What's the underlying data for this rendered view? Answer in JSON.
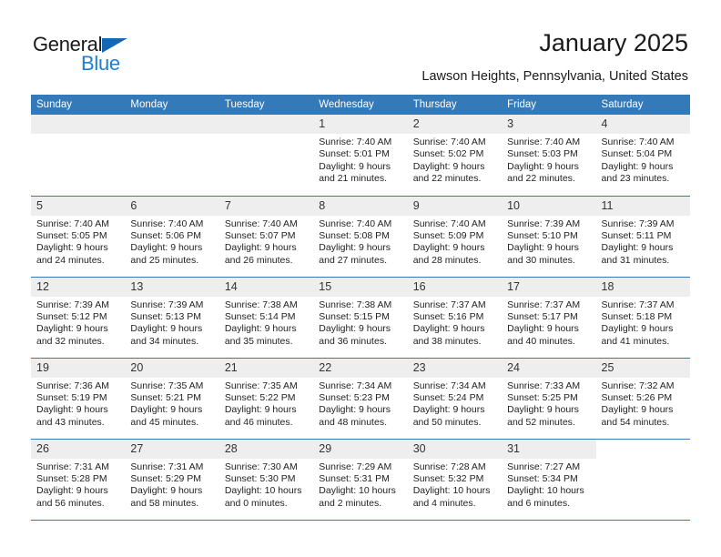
{
  "brand": {
    "name_part1": "General",
    "name_part2": "Blue",
    "color_dark": "#1a1a1a",
    "color_blue": "#1d7fd4",
    "triangle_color": "#1468b3"
  },
  "header": {
    "title": "January 2025",
    "subtitle": "Lawson Heights, Pennsylvania, United States"
  },
  "theme": {
    "header_row_bg": "#3479b8",
    "header_row_text": "#ffffff",
    "daynum_bg": "#eeeeee",
    "row_separator": "#3479b8",
    "page_bg": "#ffffff"
  },
  "calendar": {
    "weekday_headers": [
      "Sunday",
      "Monday",
      "Tuesday",
      "Wednesday",
      "Thursday",
      "Friday",
      "Saturday"
    ],
    "weeks": [
      [
        {
          "day": "",
          "blank": true
        },
        {
          "day": "",
          "blank": true
        },
        {
          "day": "",
          "blank": true
        },
        {
          "day": "1",
          "sunrise": "Sunrise: 7:40 AM",
          "sunset": "Sunset: 5:01 PM",
          "daylight1": "Daylight: 9 hours",
          "daylight2": "and 21 minutes."
        },
        {
          "day": "2",
          "sunrise": "Sunrise: 7:40 AM",
          "sunset": "Sunset: 5:02 PM",
          "daylight1": "Daylight: 9 hours",
          "daylight2": "and 22 minutes."
        },
        {
          "day": "3",
          "sunrise": "Sunrise: 7:40 AM",
          "sunset": "Sunset: 5:03 PM",
          "daylight1": "Daylight: 9 hours",
          "daylight2": "and 22 minutes."
        },
        {
          "day": "4",
          "sunrise": "Sunrise: 7:40 AM",
          "sunset": "Sunset: 5:04 PM",
          "daylight1": "Daylight: 9 hours",
          "daylight2": "and 23 minutes."
        }
      ],
      [
        {
          "day": "5",
          "sunrise": "Sunrise: 7:40 AM",
          "sunset": "Sunset: 5:05 PM",
          "daylight1": "Daylight: 9 hours",
          "daylight2": "and 24 minutes."
        },
        {
          "day": "6",
          "sunrise": "Sunrise: 7:40 AM",
          "sunset": "Sunset: 5:06 PM",
          "daylight1": "Daylight: 9 hours",
          "daylight2": "and 25 minutes."
        },
        {
          "day": "7",
          "sunrise": "Sunrise: 7:40 AM",
          "sunset": "Sunset: 5:07 PM",
          "daylight1": "Daylight: 9 hours",
          "daylight2": "and 26 minutes."
        },
        {
          "day": "8",
          "sunrise": "Sunrise: 7:40 AM",
          "sunset": "Sunset: 5:08 PM",
          "daylight1": "Daylight: 9 hours",
          "daylight2": "and 27 minutes."
        },
        {
          "day": "9",
          "sunrise": "Sunrise: 7:40 AM",
          "sunset": "Sunset: 5:09 PM",
          "daylight1": "Daylight: 9 hours",
          "daylight2": "and 28 minutes."
        },
        {
          "day": "10",
          "sunrise": "Sunrise: 7:39 AM",
          "sunset": "Sunset: 5:10 PM",
          "daylight1": "Daylight: 9 hours",
          "daylight2": "and 30 minutes."
        },
        {
          "day": "11",
          "sunrise": "Sunrise: 7:39 AM",
          "sunset": "Sunset: 5:11 PM",
          "daylight1": "Daylight: 9 hours",
          "daylight2": "and 31 minutes."
        }
      ],
      [
        {
          "day": "12",
          "sunrise": "Sunrise: 7:39 AM",
          "sunset": "Sunset: 5:12 PM",
          "daylight1": "Daylight: 9 hours",
          "daylight2": "and 32 minutes."
        },
        {
          "day": "13",
          "sunrise": "Sunrise: 7:39 AM",
          "sunset": "Sunset: 5:13 PM",
          "daylight1": "Daylight: 9 hours",
          "daylight2": "and 34 minutes."
        },
        {
          "day": "14",
          "sunrise": "Sunrise: 7:38 AM",
          "sunset": "Sunset: 5:14 PM",
          "daylight1": "Daylight: 9 hours",
          "daylight2": "and 35 minutes."
        },
        {
          "day": "15",
          "sunrise": "Sunrise: 7:38 AM",
          "sunset": "Sunset: 5:15 PM",
          "daylight1": "Daylight: 9 hours",
          "daylight2": "and 36 minutes."
        },
        {
          "day": "16",
          "sunrise": "Sunrise: 7:37 AM",
          "sunset": "Sunset: 5:16 PM",
          "daylight1": "Daylight: 9 hours",
          "daylight2": "and 38 minutes."
        },
        {
          "day": "17",
          "sunrise": "Sunrise: 7:37 AM",
          "sunset": "Sunset: 5:17 PM",
          "daylight1": "Daylight: 9 hours",
          "daylight2": "and 40 minutes."
        },
        {
          "day": "18",
          "sunrise": "Sunrise: 7:37 AM",
          "sunset": "Sunset: 5:18 PM",
          "daylight1": "Daylight: 9 hours",
          "daylight2": "and 41 minutes."
        }
      ],
      [
        {
          "day": "19",
          "sunrise": "Sunrise: 7:36 AM",
          "sunset": "Sunset: 5:19 PM",
          "daylight1": "Daylight: 9 hours",
          "daylight2": "and 43 minutes."
        },
        {
          "day": "20",
          "sunrise": "Sunrise: 7:35 AM",
          "sunset": "Sunset: 5:21 PM",
          "daylight1": "Daylight: 9 hours",
          "daylight2": "and 45 minutes."
        },
        {
          "day": "21",
          "sunrise": "Sunrise: 7:35 AM",
          "sunset": "Sunset: 5:22 PM",
          "daylight1": "Daylight: 9 hours",
          "daylight2": "and 46 minutes."
        },
        {
          "day": "22",
          "sunrise": "Sunrise: 7:34 AM",
          "sunset": "Sunset: 5:23 PM",
          "daylight1": "Daylight: 9 hours",
          "daylight2": "and 48 minutes."
        },
        {
          "day": "23",
          "sunrise": "Sunrise: 7:34 AM",
          "sunset": "Sunset: 5:24 PM",
          "daylight1": "Daylight: 9 hours",
          "daylight2": "and 50 minutes."
        },
        {
          "day": "24",
          "sunrise": "Sunrise: 7:33 AM",
          "sunset": "Sunset: 5:25 PM",
          "daylight1": "Daylight: 9 hours",
          "daylight2": "and 52 minutes."
        },
        {
          "day": "25",
          "sunrise": "Sunrise: 7:32 AM",
          "sunset": "Sunset: 5:26 PM",
          "daylight1": "Daylight: 9 hours",
          "daylight2": "and 54 minutes."
        }
      ],
      [
        {
          "day": "26",
          "sunrise": "Sunrise: 7:31 AM",
          "sunset": "Sunset: 5:28 PM",
          "daylight1": "Daylight: 9 hours",
          "daylight2": "and 56 minutes."
        },
        {
          "day": "27",
          "sunrise": "Sunrise: 7:31 AM",
          "sunset": "Sunset: 5:29 PM",
          "daylight1": "Daylight: 9 hours",
          "daylight2": "and 58 minutes."
        },
        {
          "day": "28",
          "sunrise": "Sunrise: 7:30 AM",
          "sunset": "Sunset: 5:30 PM",
          "daylight1": "Daylight: 10 hours",
          "daylight2": "and 0 minutes."
        },
        {
          "day": "29",
          "sunrise": "Sunrise: 7:29 AM",
          "sunset": "Sunset: 5:31 PM",
          "daylight1": "Daylight: 10 hours",
          "daylight2": "and 2 minutes."
        },
        {
          "day": "30",
          "sunrise": "Sunrise: 7:28 AM",
          "sunset": "Sunset: 5:32 PM",
          "daylight1": "Daylight: 10 hours",
          "daylight2": "and 4 minutes."
        },
        {
          "day": "31",
          "sunrise": "Sunrise: 7:27 AM",
          "sunset": "Sunset: 5:34 PM",
          "daylight1": "Daylight: 10 hours",
          "daylight2": "and 6 minutes."
        },
        {
          "day": "",
          "blank": true,
          "nofill": true
        }
      ]
    ]
  }
}
